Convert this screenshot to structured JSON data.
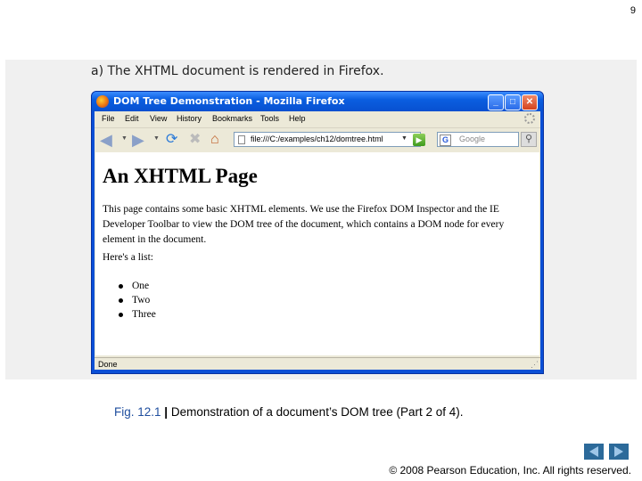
{
  "slide": {
    "number": "9"
  },
  "caption": "a) The XHTML document is rendered in Firefox.",
  "window": {
    "title": "DOM Tree Demonstration - Mozilla Firefox",
    "controls": {
      "minimize": "_",
      "maximize": "□",
      "close": "✕"
    },
    "menu": [
      "File",
      "Edit",
      "View",
      "History",
      "Bookmarks",
      "Tools",
      "Help"
    ],
    "url": "file:///C:/examples/ch12/domtree.html",
    "search_placeholder": "Google",
    "status": "Done"
  },
  "page": {
    "heading": "An XHTML Page",
    "paragraph": "This page contains some basic XHTML elements. We use the Firefox DOM Inspector and the IE Developer Toolbar to view the DOM tree of the document, which contains a DOM node for every element in the document.",
    "list_intro": "Here's a list:",
    "list_items": [
      "One",
      "Two",
      "Three"
    ]
  },
  "figure": {
    "label": "Fig. 12.1",
    "separator": "|",
    "text": "Demonstration of a document’s DOM tree (Part 2 of 4)."
  },
  "footer": {
    "copyright": "© 2008 Pearson Education, Inc. All rights reserved."
  },
  "colors": {
    "title_bar": "#0a5ee0",
    "figure_label": "#1f4e9e",
    "nav_arrow": "#2c6a9a"
  },
  "icons": [
    "firefox-icon",
    "back-arrow-icon",
    "forward-arrow-icon",
    "reload-icon",
    "stop-icon",
    "home-icon",
    "page-icon",
    "go-arrow-icon",
    "google-icon",
    "magnifier-icon",
    "throbber-icon",
    "resize-grip-icon",
    "previous-slide-icon",
    "next-slide-icon"
  ]
}
